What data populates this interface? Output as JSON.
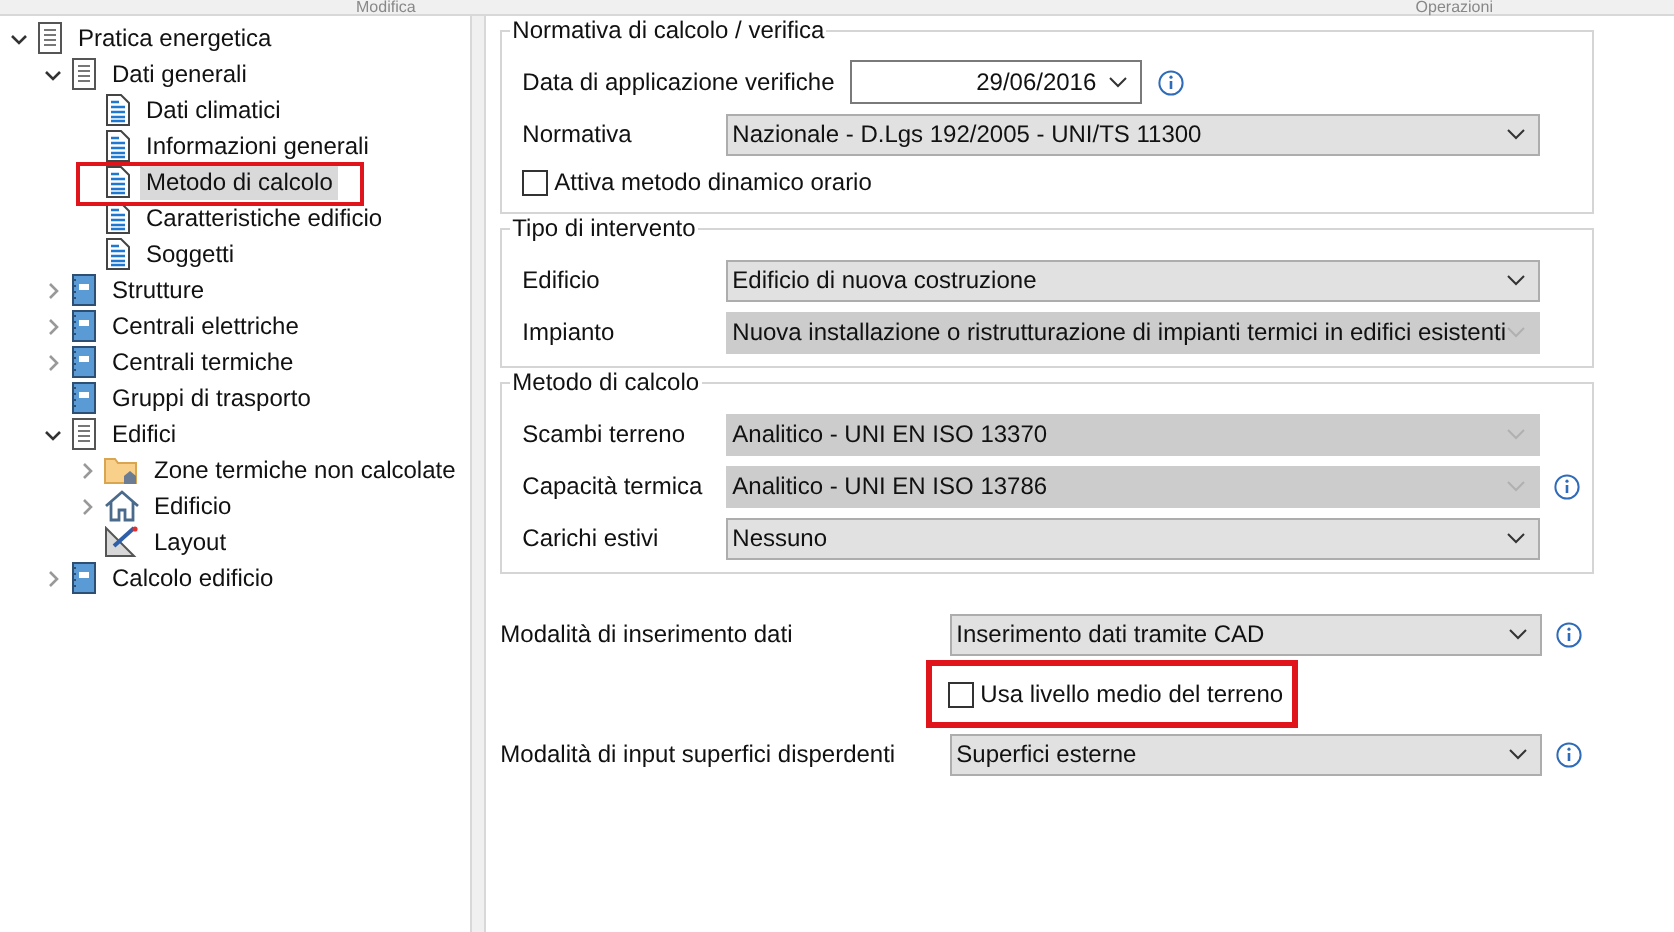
{
  "header": {
    "left": "Modifica",
    "right": "Operazioni"
  },
  "tree": [
    {
      "label": "Pratica energetica",
      "kind": "document",
      "expanded": true,
      "selected": false,
      "children": [
        {
          "label": "Dati generali",
          "kind": "document",
          "expanded": true,
          "selected": false,
          "children": [
            {
              "label": "Dati climatici",
              "kind": "page",
              "selected": false
            },
            {
              "label": "Informazioni generali",
              "kind": "page",
              "selected": false
            },
            {
              "label": "Metodo di calcolo",
              "kind": "page",
              "selected": true
            },
            {
              "label": "Caratteristiche edificio",
              "kind": "page",
              "selected": false
            },
            {
              "label": "Soggetti",
              "kind": "page",
              "selected": false
            }
          ]
        },
        {
          "label": "Strutture",
          "kind": "module",
          "expanded": false,
          "selected": false
        },
        {
          "label": "Centrali elettriche",
          "kind": "module",
          "expanded": false,
          "selected": false
        },
        {
          "label": "Centrali termiche",
          "kind": "module",
          "expanded": false,
          "selected": false
        },
        {
          "label": "Gruppi di trasporto",
          "kind": "module",
          "selected": false
        },
        {
          "label": "Edifici",
          "kind": "document",
          "expanded": true,
          "selected": false,
          "children": [
            {
              "label": "Zone termiche non calcolate",
              "kind": "folder",
              "expanded": false,
              "selected": false
            },
            {
              "label": "Edificio",
              "kind": "house",
              "expanded": false,
              "selected": false
            },
            {
              "label": "Layout",
              "kind": "ruler",
              "selected": false
            }
          ]
        },
        {
          "label": "Calcolo edificio",
          "kind": "module",
          "expanded": false,
          "selected": false
        }
      ]
    }
  ],
  "groups": [
    {
      "title": "Normativa di calcolo / verifica",
      "rows": [
        {
          "kind": "date",
          "label": "Data di applicazione verifiche",
          "value": "29/06/2016",
          "info": true
        },
        {
          "kind": "select",
          "label": "Normativa",
          "value": "Nazionale - D.Lgs 192/2005 - UNI/TS 11300",
          "disabled": false,
          "info": false
        },
        {
          "kind": "checkbox",
          "label": "Attiva metodo dinamico orario",
          "checked": false
        }
      ]
    },
    {
      "title": "Tipo di intervento",
      "rows": [
        {
          "kind": "select",
          "label": "Edificio",
          "value": "Edificio di nuova costruzione",
          "disabled": false,
          "info": false
        },
        {
          "kind": "select",
          "label": "Impianto",
          "value": "Nuova installazione o ristrutturazione di impianti termici in edifici esistenti",
          "disabled": true,
          "info": false
        }
      ]
    },
    {
      "title": "Metodo di calcolo",
      "rows": [
        {
          "kind": "select",
          "label": "Scambi terreno",
          "value": "Analitico - UNI EN ISO 13370",
          "disabled": true,
          "info": false
        },
        {
          "kind": "select",
          "label": "Capacità termica",
          "value": "Analitico - UNI EN ISO 13786",
          "disabled": true,
          "info": true
        },
        {
          "kind": "select",
          "label": "Carichi estivi",
          "value": "Nessuno",
          "disabled": false,
          "info": false
        }
      ]
    }
  ],
  "bottom_rows": [
    {
      "kind": "select",
      "label": "Modalità di inserimento dati",
      "value": "Inserimento dati tramite CAD",
      "disabled": false,
      "info": true
    },
    {
      "kind": "checkbox",
      "label": "Usa livello medio del terreno",
      "checked": false
    },
    {
      "kind": "select",
      "label": "Modalità di input superfici disperdenti",
      "value": "Superfici esterne",
      "disabled": false,
      "info": true
    }
  ]
}
